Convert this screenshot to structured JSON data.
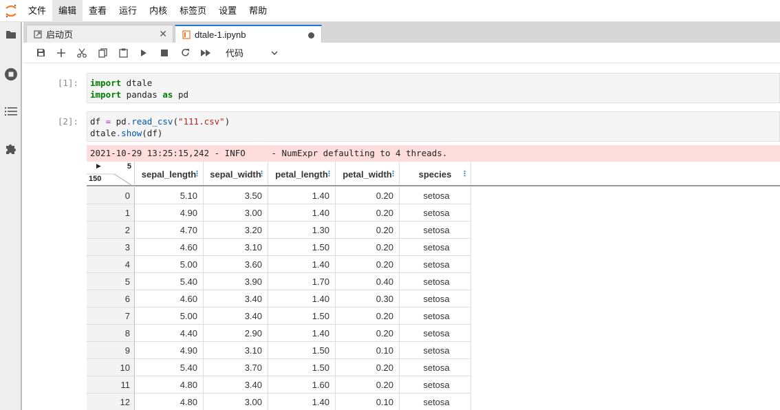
{
  "menu": [
    "文件",
    "编辑",
    "查看",
    "运行",
    "内核",
    "标签页",
    "设置",
    "帮助"
  ],
  "tabs": {
    "launcher_label": "启动页",
    "notebook_label": "dtale-1.ipynb"
  },
  "toolbar": {
    "cell_type": "代码"
  },
  "cells": {
    "c1_prompt": "[1]:",
    "c2_prompt": "[2]:"
  },
  "log": "2021-10-29 13:25:15,242 - INFO     - NumExpr defaulting to 4 threads.",
  "grid": {
    "corner_cols": "5",
    "corner_rows": "150",
    "columns": [
      "sepal_length",
      "sepal_width",
      "petal_length",
      "petal_width",
      "species"
    ],
    "rows": [
      [
        "0",
        "5.10",
        "3.50",
        "1.40",
        "0.20",
        "setosa"
      ],
      [
        "1",
        "4.90",
        "3.00",
        "1.40",
        "0.20",
        "setosa"
      ],
      [
        "2",
        "4.70",
        "3.20",
        "1.30",
        "0.20",
        "setosa"
      ],
      [
        "3",
        "4.60",
        "3.10",
        "1.50",
        "0.20",
        "setosa"
      ],
      [
        "4",
        "5.00",
        "3.60",
        "1.40",
        "0.20",
        "setosa"
      ],
      [
        "5",
        "5.40",
        "3.90",
        "1.70",
        "0.40",
        "setosa"
      ],
      [
        "6",
        "4.60",
        "3.40",
        "1.40",
        "0.30",
        "setosa"
      ],
      [
        "7",
        "5.00",
        "3.40",
        "1.50",
        "0.20",
        "setosa"
      ],
      [
        "8",
        "4.40",
        "2.90",
        "1.40",
        "0.20",
        "setosa"
      ],
      [
        "9",
        "4.90",
        "3.10",
        "1.50",
        "0.10",
        "setosa"
      ],
      [
        "10",
        "5.40",
        "3.70",
        "1.50",
        "0.20",
        "setosa"
      ],
      [
        "11",
        "4.80",
        "3.40",
        "1.60",
        "0.20",
        "setosa"
      ],
      [
        "12",
        "4.80",
        "3.00",
        "1.40",
        "0.10",
        "setosa"
      ]
    ]
  }
}
